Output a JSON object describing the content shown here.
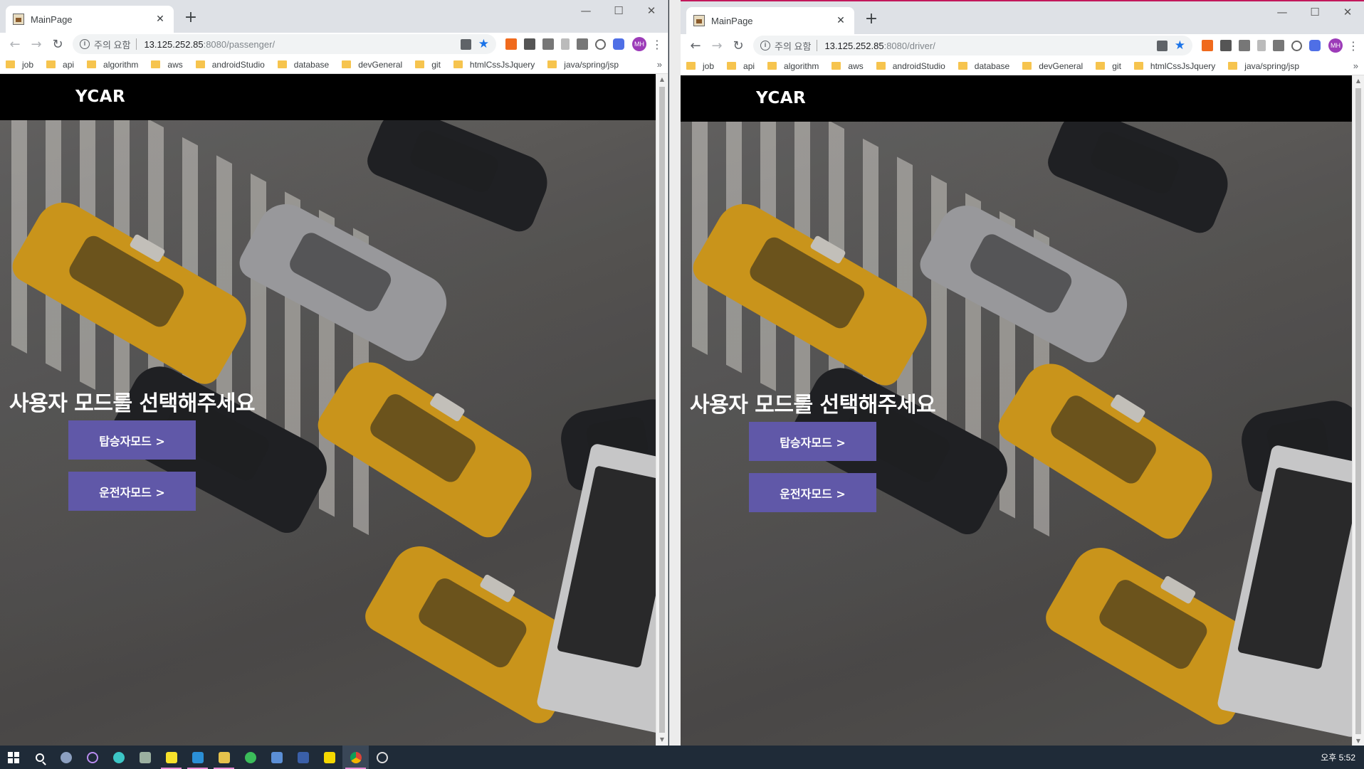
{
  "windows": [
    {
      "tab_title": "MainPage",
      "security_warning": "주의 요함",
      "url_host": "13.125.252.85",
      "url_path": ":8080/passenger/",
      "avatar_initials": "MH"
    },
    {
      "tab_title": "MainPage",
      "security_warning": "주의 요함",
      "url_host": "13.125.252.85",
      "url_path": ":8080/driver/",
      "avatar_initials": "MH"
    }
  ],
  "bookmarks": [
    "job",
    "api",
    "algorithm",
    "aws",
    "androidStudio",
    "database",
    "devGeneral",
    "git",
    "htmlCssJsJquery",
    "java/spring/jsp"
  ],
  "bookmarks_more": "»",
  "site": {
    "logo": "YCAR",
    "hero_title": "사용자 모드를 선택해주세요",
    "passenger_button": "탑승자모드 >",
    "driver_button": "운전자모드 >"
  },
  "colors": {
    "button_bg": "#6058a8",
    "header_bg": "#000000",
    "taskbar_bg": "#1f2b38"
  },
  "taskbar": {
    "clock": "오후 5:52",
    "apps": [
      "task-view-icon",
      "cortana-icon",
      "store-icon",
      "app-icon",
      "kakaotalk-icon",
      "vscode-icon",
      "file-explorer-icon",
      "line-icon",
      "app-icon",
      "visual-studio-icon",
      "sticky-notes-icon",
      "chrome-icon",
      "settings-icon"
    ]
  }
}
